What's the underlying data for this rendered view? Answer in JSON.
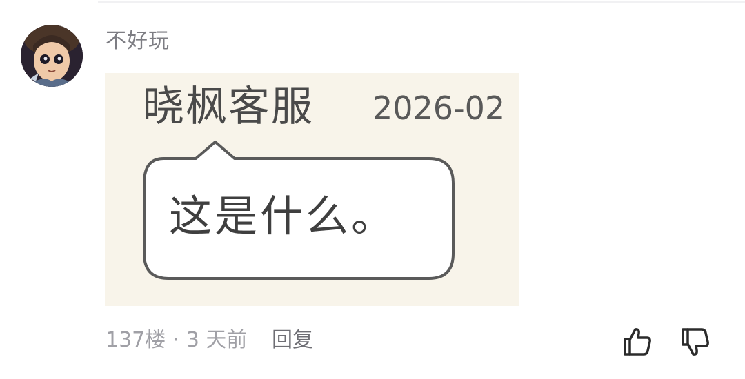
{
  "comment": {
    "username": "不好玩",
    "floor": "137楼",
    "separator": "·",
    "time_ago": "3 天前",
    "reply_label": "回复",
    "avatar_icon": "anime-character-avatar",
    "like_icon": "thumbs-up-icon",
    "dislike_icon": "thumbs-down-icon"
  },
  "meme_image": {
    "name": "晓枫客服",
    "date": "2026-02",
    "bubble_text": "这是什么。"
  }
}
